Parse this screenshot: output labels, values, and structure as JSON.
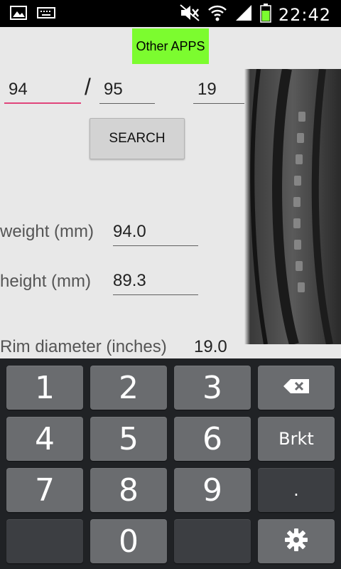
{
  "status_bar": {
    "time": "22:42",
    "icons": [
      "gallery-icon",
      "keyboard-icon",
      "mute-icon",
      "wifi-icon",
      "signal-icon",
      "battery-icon"
    ]
  },
  "app": {
    "other_apps_label": "Other APPS",
    "width_value": "94",
    "separator": "/",
    "ratio_value": "95",
    "rim_value": "19",
    "search_label": "SEARCH",
    "weight_label": "weight (mm)",
    "weight_value": "94.0",
    "height_label": "height (mm)",
    "height_value": "89.3",
    "rim_label": "Rim diameter (inches)",
    "rim_diameter_value": "19.0"
  },
  "keypad": {
    "keys": [
      "1",
      "2",
      "3",
      "4",
      "5",
      "6",
      "Brkt",
      "7",
      "8",
      "9",
      ".",
      "0"
    ],
    "backspace_icon": "backspace-icon",
    "settings_icon": "gear-icon"
  },
  "colors": {
    "other_apps_bg": "#7cfc2f",
    "active_underline": "#e0447a",
    "keypad_bg": "#202225",
    "key_bg": "#6a6c6f"
  }
}
